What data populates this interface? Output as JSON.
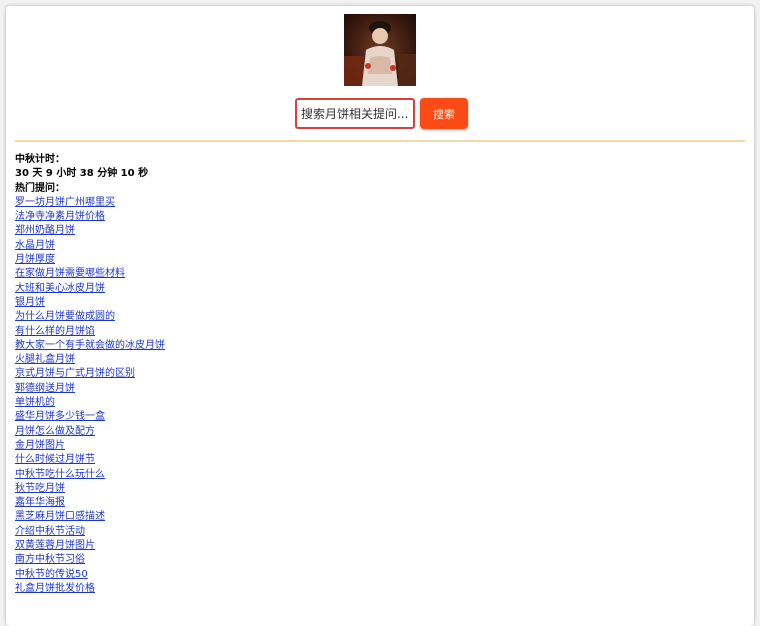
{
  "search": {
    "placeholder": "搜索月饼相关提问...",
    "button_label": "搜索"
  },
  "colors": {
    "accent": "#fa4a15",
    "input_border": "#d84040",
    "divider": "#f4d9a8",
    "link": "#1f37c9"
  },
  "countdown": {
    "label": "中秋计时：",
    "value": "30 天 9 小时 38 分钟 10 秒"
  },
  "hot_questions": {
    "label": "热门提问：",
    "items": [
      "罗一坊月饼广州哪里买",
      "法净寺净素月饼价格",
      "郑州奶酪月饼",
      "水晶月饼",
      "月饼厚度",
      "在家做月饼需要哪些材料",
      "大班和美心冰皮月饼",
      "银月饼",
      "为什么月饼要做成圆的",
      "有什么样的月饼馅",
      "教大家一个有手就会做的冰皮月饼",
      "火腿礼盒月饼",
      "京式月饼与广式月饼的区别",
      "郭德纲送月饼",
      "单饼机的",
      "盛华月饼多少钱一盒",
      "月饼怎么做及配方",
      "金月饼图片",
      "什么时候过月饼节",
      "中秋节吃什么玩什么",
      "秋节吃月饼",
      "嘉年华海报",
      "黑芝麻月饼口感描述",
      "介绍中秋节活动",
      "双黄莲蓉月饼图片",
      "南方中秋节习俗",
      "中秋节的传说50",
      "礼盒月饼批发价格"
    ]
  }
}
